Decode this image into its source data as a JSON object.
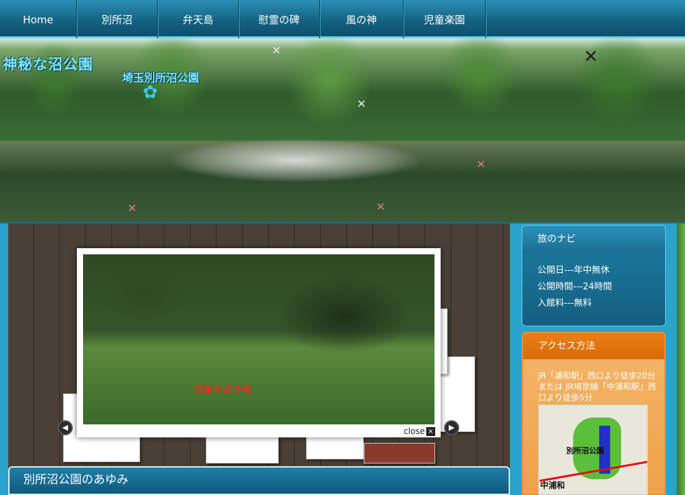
{
  "nav": {
    "items": [
      {
        "label": "Home"
      },
      {
        "label": "別所沼"
      },
      {
        "label": "弁天島"
      },
      {
        "label": "慰霊の碑"
      },
      {
        "label": "風の神"
      },
      {
        "label": "児童楽園"
      }
    ]
  },
  "banner": {
    "title": "神秘な沼公園",
    "subtitle": "埼玉別所沼公園"
  },
  "lightbox": {
    "caption": "宗像そばの滝",
    "close_label": "close",
    "close_icon": "×"
  },
  "section": {
    "title": "別所沼公園のあゆみ"
  },
  "sidebar": {
    "nav_box": {
      "title": "旅のナビ",
      "lines": [
        "公開日---年中無休",
        "公開時間---24時間",
        "入館料---無料"
      ]
    },
    "access_box": {
      "title": "アクセス方法",
      "text": "JR「浦和駅」西口より徒歩20分または JR埼京線「中浦和駅」西口より徒歩5分",
      "map_label": "別所沼公園",
      "map_station": "中浦和"
    }
  },
  "icons": {
    "prev": "◀",
    "next": "▶"
  }
}
